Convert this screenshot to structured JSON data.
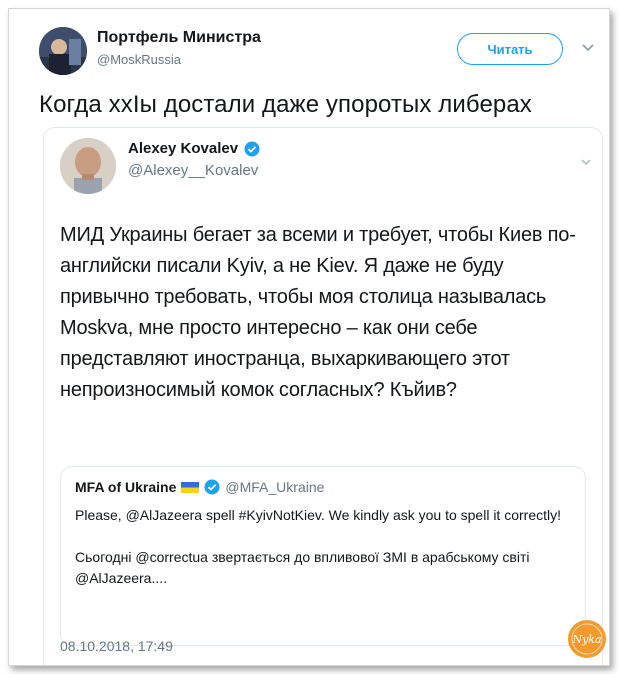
{
  "outer_tweet": {
    "display_name": "Портфель Министра",
    "handle": "@MoskRussia",
    "follow_label": "Читать",
    "text": "Когда хxIы достали даже упоротых либерах"
  },
  "inner_tweet": {
    "display_name": "Alexey Kovalev",
    "handle": "@Alexey__Kovalev",
    "text": "МИД Украины бегает за всеми и требует, чтобы Киев по-английски писали Kyiv, а не Kiev. Я даже не буду привычно требовать, чтобы моя столица называлась Moskva, мне просто интересно – как они себе представляют иностранца, выхаркивающего этот непроизносимый комок согласных? Къйив?",
    "timestamp": "08.10.2018, 17:49"
  },
  "quoted_tweet": {
    "display_name": "MFA of Ukraine",
    "handle": "@MFA_Ukraine",
    "paragraph_1": "Please, @AlJazeera spell #KyivNotKiev. We kindly ask you to spell it correctly!",
    "paragraph_2": "Сьогодні @correctua звертається до впливової ЗМІ в арабському світі @AlJazeera...."
  },
  "watermark": {
    "text": "Nyka"
  },
  "colors": {
    "accent": "#1da1f2",
    "secondary_text": "#657786",
    "border": "#e1e8ed",
    "watermark": "#f39a2e"
  }
}
